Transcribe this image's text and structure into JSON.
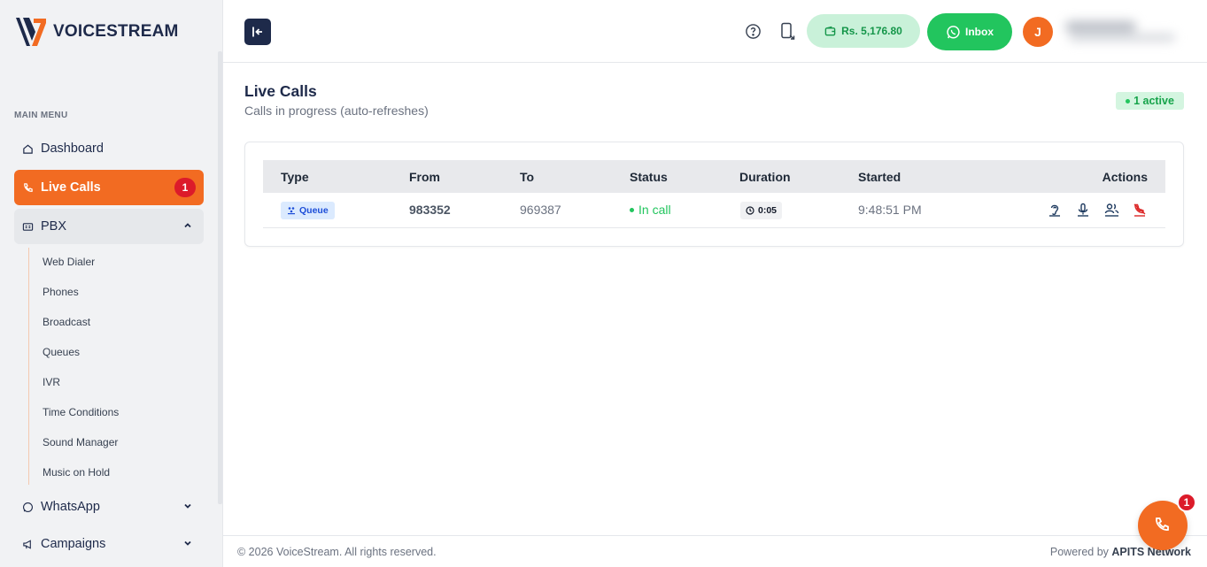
{
  "brand": {
    "name": "VOICESTREAM",
    "accent": "#f26b22",
    "navy": "#1e2a4a"
  },
  "sidebar": {
    "heading": "MAIN MENU",
    "items": [
      {
        "label": "Dashboard",
        "icon": "home-icon"
      },
      {
        "label": "Live Calls",
        "icon": "phone-call-icon",
        "badge": "1",
        "active": true
      },
      {
        "label": "PBX",
        "icon": "pbx-icon",
        "expanded": true
      },
      {
        "label": "WhatsApp",
        "icon": "whatsapp-icon"
      },
      {
        "label": "Campaigns",
        "icon": "megaphone-icon"
      }
    ],
    "pbx_submenu": [
      "Web Dialer",
      "Phones",
      "Broadcast",
      "Queues",
      "IVR",
      "Time Conditions",
      "Sound Manager",
      "Music on Hold"
    ]
  },
  "header": {
    "balance": "Rs. 5,176.80",
    "inbox_label": "Inbox",
    "avatar_initial": "J"
  },
  "page": {
    "title": "Live Calls",
    "subtitle": "Calls in progress (auto-refreshes)",
    "active_count": "1 active"
  },
  "table": {
    "columns": [
      "Type",
      "From",
      "To",
      "Status",
      "Duration",
      "Started",
      "Actions"
    ],
    "rows": [
      {
        "type": "Queue",
        "from": "983352",
        "to": "969387",
        "status": "In call",
        "duration": "0:05",
        "started": "9:48:51 PM",
        "actions": [
          "listen-icon",
          "whisper-icon",
          "barge-icon",
          "hangup-icon"
        ]
      }
    ]
  },
  "footer": {
    "copyright": "© 2026 VoiceStream. All rights reserved.",
    "powered_prefix": "Powered by",
    "powered_by": "APITS Network"
  },
  "fab": {
    "badge": "1"
  }
}
